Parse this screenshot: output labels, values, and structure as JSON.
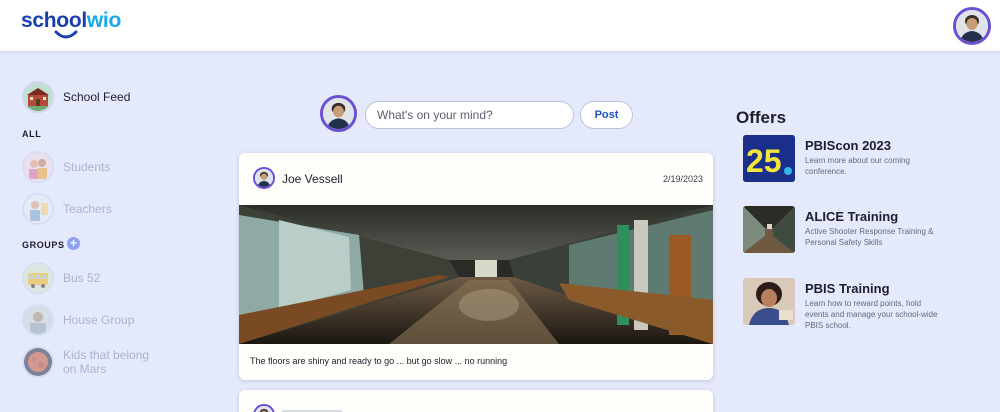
{
  "app": {
    "logo_part1": "school",
    "logo_part2": "wio"
  },
  "sidebar": {
    "feed_label": "School Feed",
    "all_label": "ALL",
    "groups_label": "GROUPS",
    "add_group_symbol": "+",
    "all_items": [
      {
        "label": "Students"
      },
      {
        "label": "Teachers"
      }
    ],
    "groups": [
      {
        "label": "Bus 52"
      },
      {
        "label": "House Group"
      },
      {
        "label": "Kids that belong on Mars"
      }
    ]
  },
  "composer": {
    "placeholder": "What's on your mind?",
    "post_label": "Post"
  },
  "posts": [
    {
      "author": "Joe Vessell",
      "date": "2/19/2023",
      "caption": "The floors are shiny and ready to go ... but go slow ... no running"
    }
  ],
  "offers": {
    "title": "Offers",
    "items": [
      {
        "title": "PBIScon 2023",
        "thumb_text": "25",
        "description": "Learn more about our coming conference."
      },
      {
        "title": "ALICE Training",
        "description": "Active Shooter Response Training & Personal Safety Skills"
      },
      {
        "title": "PBIS Training",
        "description": "Learn how to reward points, hold events and manage your school-wide PBIS school."
      }
    ]
  },
  "colors": {
    "background": "#e4e9fb",
    "accent": "#6b4fd4",
    "logo_dark": "#1a3fae",
    "logo_light": "#17a9e8",
    "post_button_text": "#1a4fc6"
  }
}
